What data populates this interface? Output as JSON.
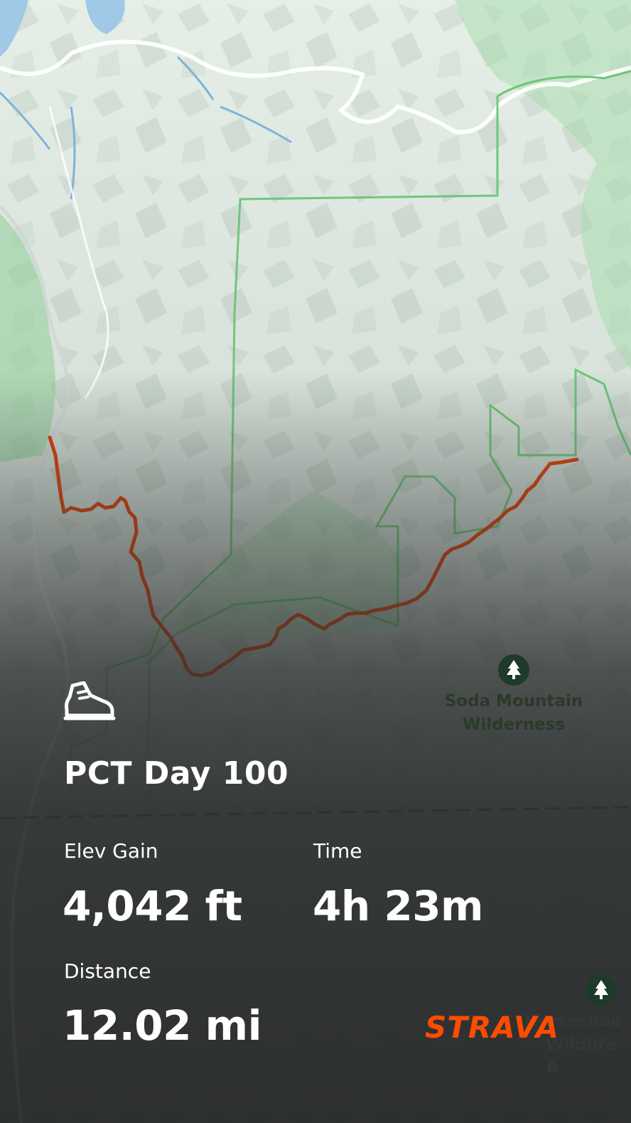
{
  "activity": {
    "icon": "hiking-boot-icon",
    "title": "PCT Day 100"
  },
  "stats": {
    "elev_gain": {
      "label": "Elev Gain",
      "value": "4,042 ft"
    },
    "time": {
      "label": "Time",
      "value": "4h 23m"
    },
    "distance": {
      "label": "Distance",
      "value": "12.02 mi"
    }
  },
  "map": {
    "labels": {
      "soda_mountain": [
        "Soda Mountain",
        "Wilderness"
      ],
      "horseshoe": [
        "Horseshoe",
        "Wildlife A"
      ]
    },
    "route_color": "#d9440f",
    "boundary_color": "#5fbf6a"
  },
  "brand": {
    "name": "STRAVA",
    "color": "#fc4c02"
  }
}
